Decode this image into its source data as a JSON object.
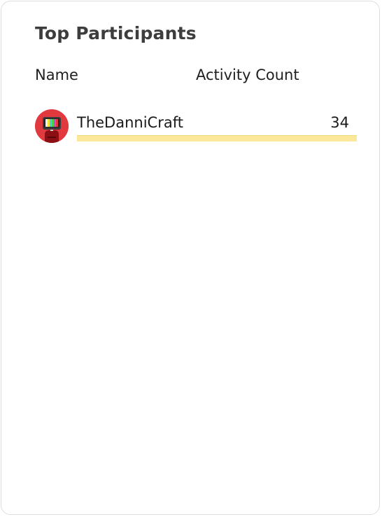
{
  "card": {
    "title": "Top Participants"
  },
  "columns": {
    "name": "Name",
    "count": "Activity Count"
  },
  "participants": [
    {
      "name": "TheDanniCraft",
      "count": "34",
      "bar_fraction": 1.0,
      "avatar_icon": "tv-head-avatar-icon"
    }
  ],
  "colors": {
    "bar": "#fbe89a",
    "avatar_bg": "#e0393e",
    "title": "#3d3d3d"
  }
}
